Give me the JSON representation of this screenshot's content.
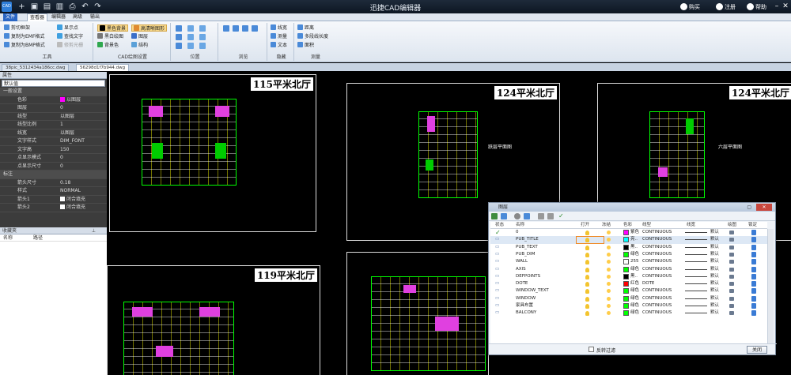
{
  "titlebar": {
    "title": "迅捷CAD编辑器",
    "icon_text": "CAD",
    "buy": "购买",
    "register": "注册",
    "help": "帮助"
  },
  "menu": {
    "file": "文件",
    "items": [
      "查看器",
      "编辑器",
      "高级",
      "输出"
    ]
  },
  "ribbon": {
    "tools": {
      "items": [
        "剪切框架",
        "复制为EMF格式",
        "复制为BMP格式",
        "显示点",
        "查找文字",
        "修剪光栅"
      ],
      "label": "工具"
    },
    "draw_settings": {
      "items": [
        "黑色背景",
        "黑白绘图",
        "背景色",
        "图层",
        "结构",
        "高清晰图形"
      ],
      "label": "CAD绘图设置"
    },
    "position": {
      "label": "位置"
    },
    "browse": {
      "label": "浏览"
    },
    "hide": {
      "items": [
        "线宽",
        "测量",
        "文本"
      ],
      "label": "隐藏"
    },
    "measure": {
      "items": [
        "距离",
        "多段线长度",
        "面积"
      ],
      "label": "测量"
    }
  },
  "tabs": [
    "38pic_5312434a186cc.dwg",
    "56298d1f7b944.dwg"
  ],
  "properties": {
    "header": "属性",
    "selector": "默认值",
    "sections": [
      {
        "title": "一般设置",
        "rows": [
          {
            "k": "色彩",
            "v": "以图层",
            "swatch": "#ff00ff"
          },
          {
            "k": "图层",
            "v": "0"
          },
          {
            "k": "线型",
            "v": "以图层"
          },
          {
            "k": "线型比例",
            "v": "1"
          },
          {
            "k": "线宽",
            "v": "以图层"
          },
          {
            "k": "文字样式",
            "v": "DIM_FONT"
          },
          {
            "k": "文字高",
            "v": "150"
          },
          {
            "k": "点显示模式",
            "v": "0"
          },
          {
            "k": "点显示尺寸",
            "v": "0"
          }
        ]
      },
      {
        "title": "标注",
        "rows": [
          {
            "k": "箭头尺寸",
            "v": "0.18"
          },
          {
            "k": "样式",
            "v": "NORMAL"
          },
          {
            "k": "箭头1",
            "v": "闭合填充"
          },
          {
            "k": "箭头2",
            "v": "闭合填充"
          }
        ]
      }
    ]
  },
  "favorites": {
    "header": "收藏夹",
    "col_name": "名称",
    "col_path": "路径"
  },
  "drawings": [
    {
      "title": "115平米北厅",
      "label": ""
    },
    {
      "title": "124平米北厅",
      "label": "跃层平面图"
    },
    {
      "title": "124平米北厅",
      "label": "六层平面图"
    },
    {
      "title": "119平米北厅",
      "label": ""
    }
  ],
  "layer_dialog": {
    "title": "图层",
    "headers": {
      "status": "状态",
      "name": "名称",
      "on": "打开",
      "freeze": "冻结",
      "color": "色彩",
      "linetype": "线型",
      "lineweight": "线宽",
      "plot": "绘图",
      "lock": "锁定"
    },
    "layers": [
      {
        "name": "0",
        "color": "紫色",
        "hex": "#ff00ff",
        "lt": "CONTINUOUS",
        "lw": "默认",
        "current": true
      },
      {
        "name": "PUB_TITLE",
        "color": "亮..",
        "hex": "#00ffff",
        "lt": "CONTINUOUS",
        "lw": "默认"
      },
      {
        "name": "PUB_TEXT",
        "color": "黑..",
        "hex": "#000000",
        "lt": "CONTINUOUS",
        "lw": "默认"
      },
      {
        "name": "PUB_DIM",
        "color": "绿色",
        "hex": "#00ff00",
        "lt": "CONTINUOUS",
        "lw": "默认"
      },
      {
        "name": "WALL",
        "color": "255",
        "hex": "#ffffff",
        "lt": "CONTINUOUS",
        "lw": "默认"
      },
      {
        "name": "AXIS",
        "color": "绿色",
        "hex": "#00ff00",
        "lt": "CONTINUOUS",
        "lw": "默认"
      },
      {
        "name": "DEFPOINTS",
        "color": "黑..",
        "hex": "#000000",
        "lt": "CONTINUOUS",
        "lw": "默认"
      },
      {
        "name": "DOTE",
        "color": "红色",
        "hex": "#ff0000",
        "lt": "DOTE",
        "lw": "默认"
      },
      {
        "name": "WINDOW_TEXT",
        "color": "绿色",
        "hex": "#00ff00",
        "lt": "CONTINUOUS",
        "lw": "默认"
      },
      {
        "name": "WINDOW",
        "color": "绿色",
        "hex": "#00ff00",
        "lt": "CONTINUOUS",
        "lw": "默认"
      },
      {
        "name": "家具布置",
        "color": "绿色",
        "hex": "#00ff00",
        "lt": "CONTINUOUS",
        "lw": "默认"
      },
      {
        "name": "BALCONY",
        "color": "绿色",
        "hex": "#00ff00",
        "lt": "CONTINUOUS",
        "lw": "默认"
      }
    ],
    "reverse_filter": "反转过滤",
    "close": "关闭"
  },
  "watermark": "jingyan.baidu.com"
}
